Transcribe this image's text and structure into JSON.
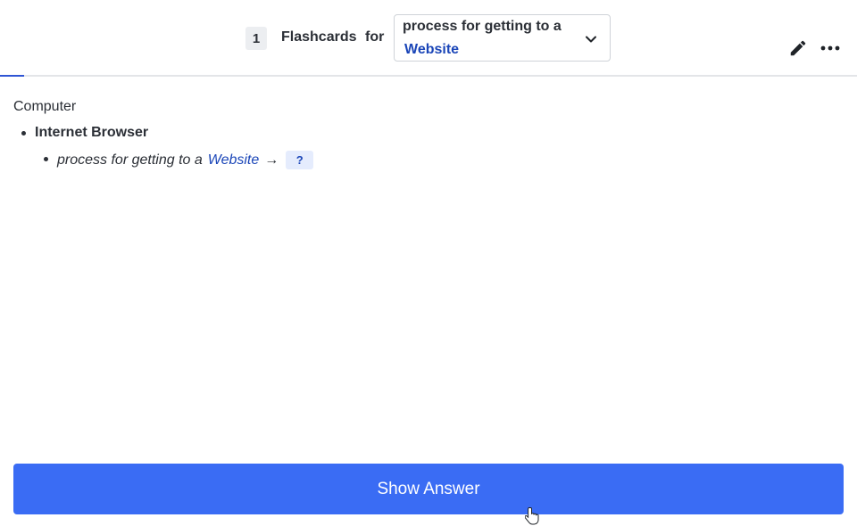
{
  "header": {
    "count": "1",
    "title": "Flashcards",
    "for": "for",
    "deck_select": {
      "line1": "process for getting to a",
      "line2": "Website"
    },
    "icons": {
      "chevron": "chevron-down-icon",
      "edit": "pencil-icon",
      "more": "more-horizontal-icon"
    }
  },
  "card": {
    "parent": "Computer",
    "child": "Internet Browser",
    "question": {
      "text": "process for getting to a",
      "link": "Website",
      "arrow": "→",
      "cloze": "?"
    }
  },
  "footer": {
    "show_answer_label": "Show Answer"
  },
  "colors": {
    "accent": "#3a6cf4",
    "link": "#1b46b8",
    "cloze_bg": "#e5ecfd"
  }
}
